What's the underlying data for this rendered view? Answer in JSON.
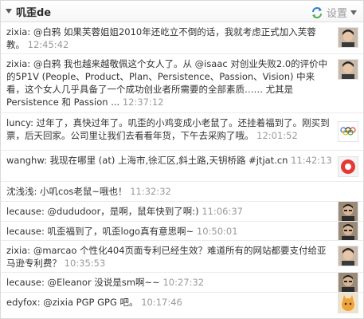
{
  "header": {
    "title": "叽歪de",
    "settings_label": "设置"
  },
  "items": [
    {
      "user": "zixia",
      "text": "@白鸦 如果芙蓉姐姐2010年还屹立不倒的话，我就考虑正式加入芙蓉教。",
      "time": "12:45:42",
      "avatar": "avatar-person-dark-hair"
    },
    {
      "user": "zixia",
      "text": "@白鸦 我也越来越敬佩这个女人了。从 @isaac 对创业失败2.0的评价中的5P1V (People、Product、Plan、Persistence、Passion、Vision) 中来看，这个女人几乎具备了一个成功创业者所需要的全部素质…… 尤其是 Persistence 和 Passion ...",
      "time": "12:37:12",
      "avatar": "avatar-person-dark-hair"
    },
    {
      "user": "luncy",
      "text": "过年了，真快过年了。叽歪的小鸡变成小老鼠了。还挂着福到了。刚买到票，后天回家。公司里让我们去看看年货，下午去采购了哦。",
      "time": "12:01:52",
      "avatar": "avatar-olympic-rings"
    },
    {
      "user": "wanghw",
      "text": "我现在哪里 (at) 上海市,徐汇区,斜土路,天钥桥路 #jtjat.cn",
      "time": "11:42:13",
      "avatar": "avatar-red-circle"
    },
    {
      "user": "沈浅浅",
      "text": "小叽cos老鼠~哦也！",
      "time": "11:32:32",
      "avatar": "avatar-blank"
    },
    {
      "user": "lecause",
      "text": "@dudud​oor，是啊，鼠年快到了啊:)",
      "time": "11:06:37",
      "avatar": "avatar-person-glasses"
    },
    {
      "user": "lecause",
      "text": "叽歪福到了，叽歪logo真有意思啊~",
      "time": "10:50:01",
      "avatar": "avatar-person-glasses"
    },
    {
      "user": "zixia",
      "text": "@marcao 个性化404页面专利已经生效？难道所有的网站都要支付给亚马逊专利费？",
      "time": "10:35:53",
      "avatar": "avatar-person-dark-hair"
    },
    {
      "user": "lecause",
      "text": "@Eleanor 没说是sm啊~~",
      "time": "10:27:32",
      "avatar": "avatar-person-glasses"
    },
    {
      "user": "edyfox",
      "text": "@zixia PGP GPG 吧。",
      "time": "10:17:46",
      "avatar": "avatar-orange-cat"
    }
  ]
}
